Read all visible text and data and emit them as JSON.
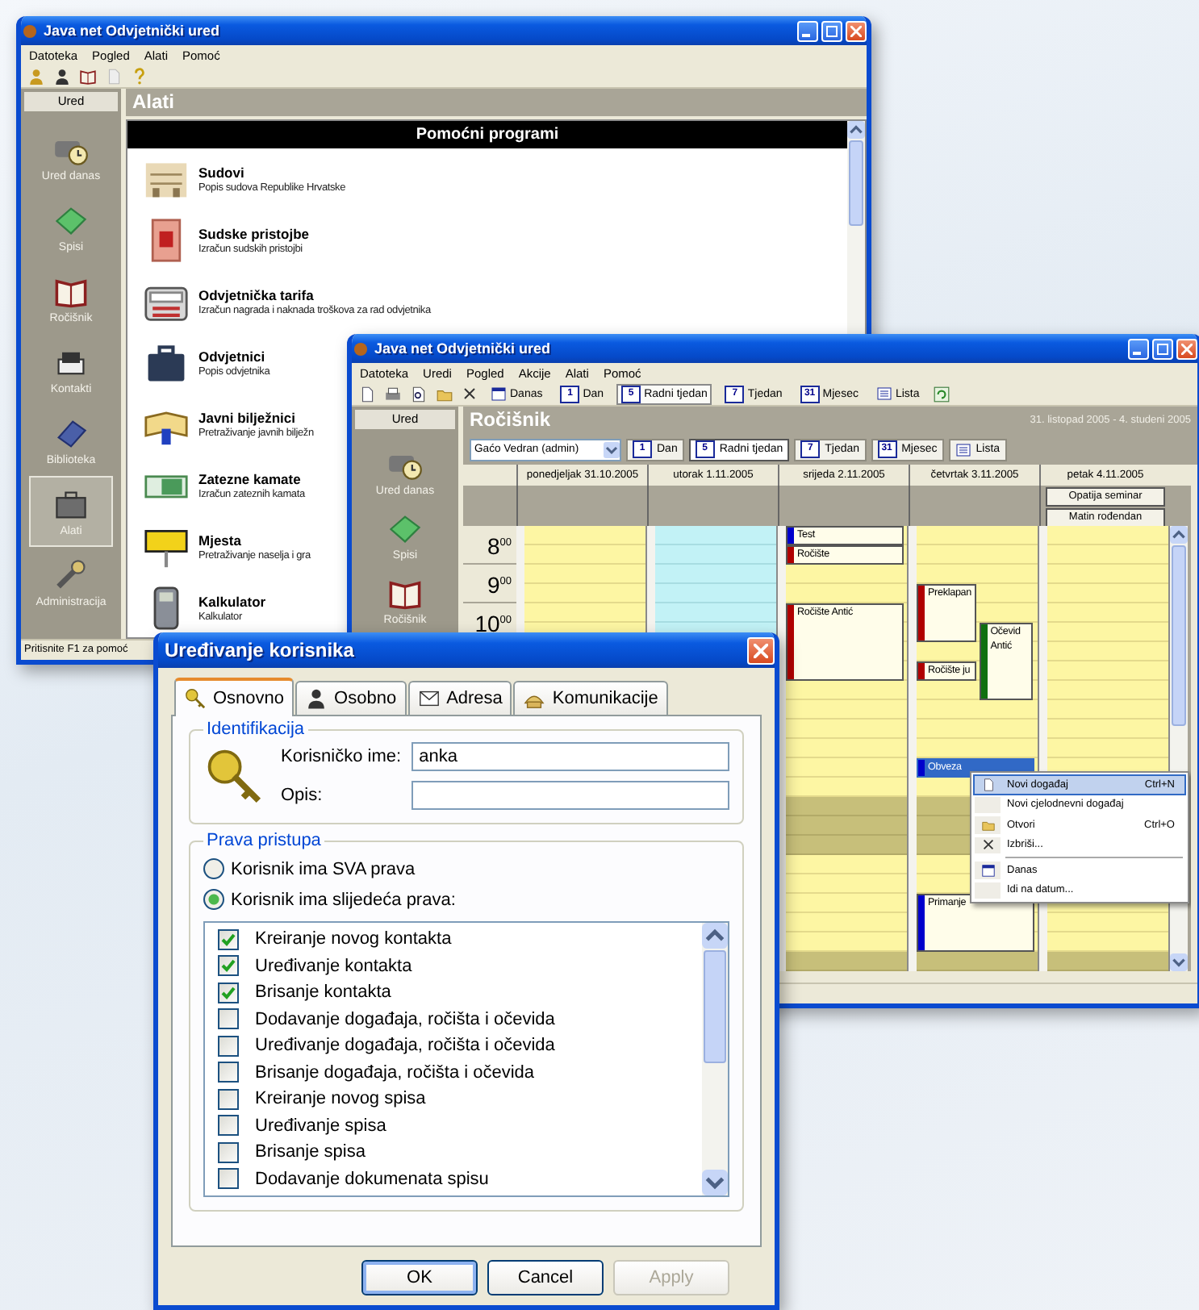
{
  "main_window": {
    "title": "Java net Odvjetnički ured",
    "menu": [
      "Datoteka",
      "Pogled",
      "Alati",
      "Pomoć"
    ],
    "sidebar": {
      "header": "Ured",
      "items": [
        {
          "label": "Ured danas",
          "selected": false
        },
        {
          "label": "Spisi",
          "selected": false
        },
        {
          "label": "Ročišnik",
          "selected": false
        },
        {
          "label": "Kontakti",
          "selected": false
        },
        {
          "label": "Biblioteka",
          "selected": false
        },
        {
          "label": "Alati",
          "selected": true
        },
        {
          "label": "Administracija",
          "selected": false
        }
      ]
    },
    "panel_title": "Alati",
    "section_title": "Pomoćni programi",
    "tools": [
      {
        "name": "Sudovi",
        "description": "Popis sudova Republike Hrvatske"
      },
      {
        "name": "Sudske pristojbe",
        "description": "Izračun sudskih pristojbi"
      },
      {
        "name": "Odvjetnička tarifa",
        "description": "Izračun nagrada i naknada troškova za rad odvjetnika"
      },
      {
        "name": "Odvjetnici",
        "description": "Popis odvjetnika"
      },
      {
        "name": "Javni bilježnici",
        "description": "Pretraživanje javnih bilježn"
      },
      {
        "name": "Zatezne kamate",
        "description": "Izračun zateznih kamata"
      },
      {
        "name": "Mjesta",
        "description": "Pretraživanje naselja i gra"
      },
      {
        "name": "Kalkulator",
        "description": "Kalkulator"
      }
    ],
    "status_bar": "Pritisnite F1 za pomoć"
  },
  "calendar_window": {
    "title": "Java net Odvjetnički ured",
    "menu": [
      "Datoteka",
      "Uredi",
      "Pogled",
      "Akcije",
      "Alati",
      "Pomoć"
    ],
    "toolbar": [
      {
        "kind": "today",
        "label": "Danas",
        "selected": false
      },
      {
        "kind": "number",
        "icon_text": "1",
        "label": "Dan",
        "selected": false
      },
      {
        "kind": "number",
        "icon_text": "5",
        "label": "Radni tjedan",
        "selected": true
      },
      {
        "kind": "number",
        "icon_text": "7",
        "label": "Tjedan",
        "selected": false
      },
      {
        "kind": "number",
        "icon_text": "31",
        "label": "Mjesec",
        "selected": false
      },
      {
        "kind": "list",
        "label": "Lista",
        "selected": false
      }
    ],
    "sidebar": {
      "header": "Ured",
      "items": [
        {
          "label": "Ured danas"
        },
        {
          "label": "Spisi"
        },
        {
          "label": "Ročišnik"
        }
      ]
    },
    "panel_title": "Ročišnik",
    "date_range": "31. listopad 2005 - 4. studeni 2005",
    "user_select": "Gaćo Vedran (admin)",
    "view_buttons": [
      {
        "kind": "number",
        "icon_text": "1",
        "label": "Dan",
        "selected": false
      },
      {
        "kind": "number",
        "icon_text": "5",
        "label": "Radni tjedan",
        "selected": true
      },
      {
        "kind": "number",
        "icon_text": "7",
        "label": "Tjedan",
        "selected": false
      },
      {
        "kind": "number",
        "icon_text": "31",
        "label": "Mjesec",
        "selected": false
      },
      {
        "kind": "list",
        "label": "Lista",
        "selected": false
      }
    ],
    "days": [
      {
        "label": "ponedjeljak 31.10.2005",
        "today": false
      },
      {
        "label": "utorak 1.11.2005",
        "today": true
      },
      {
        "label": "srijeda 2.11.2005",
        "today": false
      },
      {
        "label": "četvrtak 3.11.2005",
        "today": false
      },
      {
        "label": "petak 4.11.2005",
        "today": false
      }
    ],
    "hours": [
      "8$^{00}$",
      "9$^{00}$",
      "10$^{00}$"
    ],
    "all_day_events": [
      "Opatija seminar",
      "Matin rođendan"
    ],
    "events": [
      {
        "title": "Test",
        "color": "#0000cc",
        "selected": false
      },
      {
        "title": "Ročište",
        "color": "#b00000",
        "selected": false
      },
      {
        "title": "Ročište Antić",
        "color": "#b00000",
        "selected": false
      },
      {
        "title": "Preklapan",
        "color": "#b00000",
        "selected": false
      },
      {
        "title": "Očevid Antić",
        "color": "#107010",
        "selected": false
      },
      {
        "title": "Ročište ju",
        "color": "#b00000",
        "selected": false
      },
      {
        "title": "Obveza",
        "color": "#0000cc",
        "selected": true
      },
      {
        "title": "Primanje",
        "color": "#0000cc",
        "selected": false
      }
    ],
    "context_menu": [
      [
        {
          "label": "Novi događaj",
          "shortcut": "Ctrl+N",
          "selected": true
        },
        {
          "label": "Novi cjelodnevni događaj",
          "selected": false
        },
        {
          "label": "Otvori",
          "shortcut": "Ctrl+O",
          "selected": false
        },
        {
          "label": "Izbriši...",
          "selected": false
        }
      ],
      [
        {
          "label": "Danas",
          "selected": false
        },
        {
          "label": "Idi na datum...",
          "selected": false
        }
      ]
    ]
  },
  "dialog": {
    "title": "Uređivanje korisnika",
    "tabs": [
      {
        "label": "Osnovno",
        "selected": true
      },
      {
        "label": "Osobno",
        "selected": false
      },
      {
        "label": "Adresa",
        "selected": false
      },
      {
        "label": "Komunikacije",
        "selected": false
      }
    ],
    "identification": {
      "legend": "Identifikacija",
      "username_label": "Korisničko ime:",
      "username": "anka",
      "description_label": "Opis:"
    },
    "rights": {
      "legend": "Prava pristupa",
      "options": [
        {
          "label": "Korisnik ima SVA prava",
          "selected": false
        },
        {
          "label": "Korisnik ima slijedeća prava:",
          "selected": true
        }
      ],
      "permissions": [
        {
          "label": "Kreiranje novog kontakta",
          "checked": true
        },
        {
          "label": "Uređivanje kontakta",
          "checked": true
        },
        {
          "label": "Brisanje kontakta",
          "checked": true
        },
        {
          "label": "Dodavanje događaja, ročišta i očevida",
          "checked": false
        },
        {
          "label": "Uređivanje događaja, ročišta i očevida",
          "checked": false
        },
        {
          "label": "Brisanje događaja, ročišta i očevida",
          "checked": false
        },
        {
          "label": "Kreiranje novog spisa",
          "checked": false
        },
        {
          "label": "Uređivanje spisa",
          "checked": false
        },
        {
          "label": "Brisanje spisa",
          "checked": false
        },
        {
          "label": "Dodavanje dokumenata spisu",
          "checked": false
        }
      ]
    },
    "buttons": [
      {
        "label": "OK",
        "disabled": false
      },
      {
        "label": "Cancel",
        "disabled": false
      },
      {
        "label": "Apply",
        "disabled": true
      }
    ]
  }
}
